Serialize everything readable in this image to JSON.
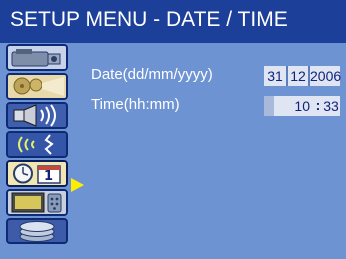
{
  "title": "SETUP MENU - DATE / TIME",
  "sidebar": {
    "items": [
      {
        "icon": "camcorder-icon",
        "selected": false
      },
      {
        "icon": "film-reel-projector-icon",
        "selected": false
      },
      {
        "icon": "speaker-icon",
        "selected": false
      },
      {
        "icon": "wireless-signal-icon",
        "selected": false
      },
      {
        "icon": "clock-calendar-icon",
        "selected": true,
        "calendar_number": "1"
      },
      {
        "icon": "tv-remote-icon",
        "selected": false
      },
      {
        "icon": "disc-stack-icon",
        "selected": false
      }
    ]
  },
  "date": {
    "label": "Date(dd/mm/yyyy)",
    "day": "31",
    "month": "12",
    "year": "2006"
  },
  "time": {
    "label": "Time(hh:mm)",
    "hour": "10",
    "separator": ":",
    "minute": "33"
  },
  "colors": {
    "title_bar": "#1c3f9a",
    "background": "#6e93d2",
    "pointer": "#ffee00",
    "field_text": "#10237a"
  }
}
